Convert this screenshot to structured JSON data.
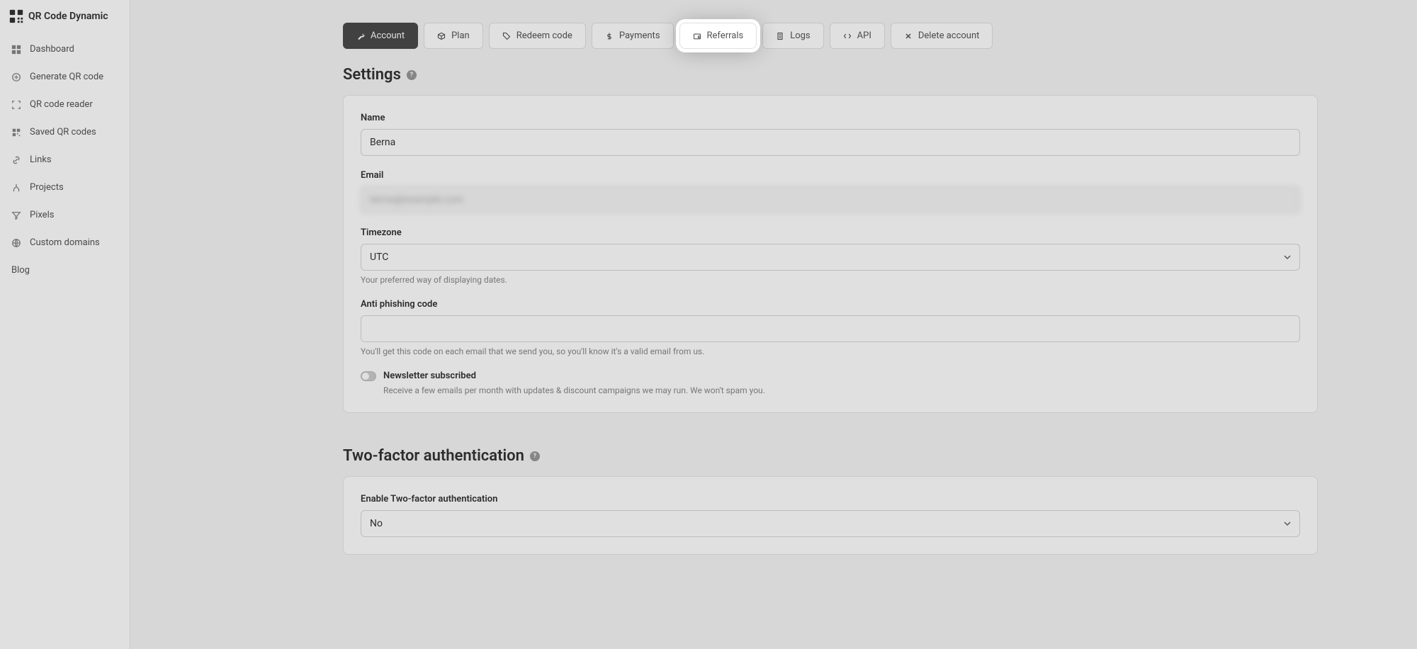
{
  "brand": {
    "name": "QR Code Dynamic"
  },
  "sidebar": {
    "items": [
      {
        "label": "Dashboard",
        "icon": "grid-icon"
      },
      {
        "label": "Generate QR code",
        "icon": "plus-circle-icon"
      },
      {
        "label": "QR code reader",
        "icon": "scan-icon"
      },
      {
        "label": "Saved QR codes",
        "icon": "qr-icon"
      },
      {
        "label": "Links",
        "icon": "link-icon"
      },
      {
        "label": "Projects",
        "icon": "project-icon"
      },
      {
        "label": "Pixels",
        "icon": "filter-icon"
      },
      {
        "label": "Custom domains",
        "icon": "globe-icon"
      },
      {
        "label": "Blog",
        "icon": ""
      }
    ]
  },
  "tabs": {
    "account": "Account",
    "plan": "Plan",
    "redeem": "Redeem code",
    "payments": "Payments",
    "referrals": "Referrals",
    "logs": "Logs",
    "api": "API",
    "delete": "Delete account"
  },
  "settings": {
    "title": "Settings",
    "name_label": "Name",
    "name_value": "Berna",
    "email_label": "Email",
    "email_value": "berna@example.com",
    "timezone_label": "Timezone",
    "timezone_value": "UTC",
    "timezone_help": "Your preferred way of displaying dates.",
    "anti_phishing_label": "Anti phishing code",
    "anti_phishing_value": "",
    "anti_phishing_help": "You'll get this code on each email that we send you, so you'll know it's a valid email from us.",
    "newsletter_label": "Newsletter subscribed",
    "newsletter_help": "Receive a few emails per month with updates & discount campaigns we may run. We won't spam you."
  },
  "twofa": {
    "title": "Two-factor authentication",
    "enable_label": "Enable Two-factor authentication",
    "enable_value": "No"
  }
}
